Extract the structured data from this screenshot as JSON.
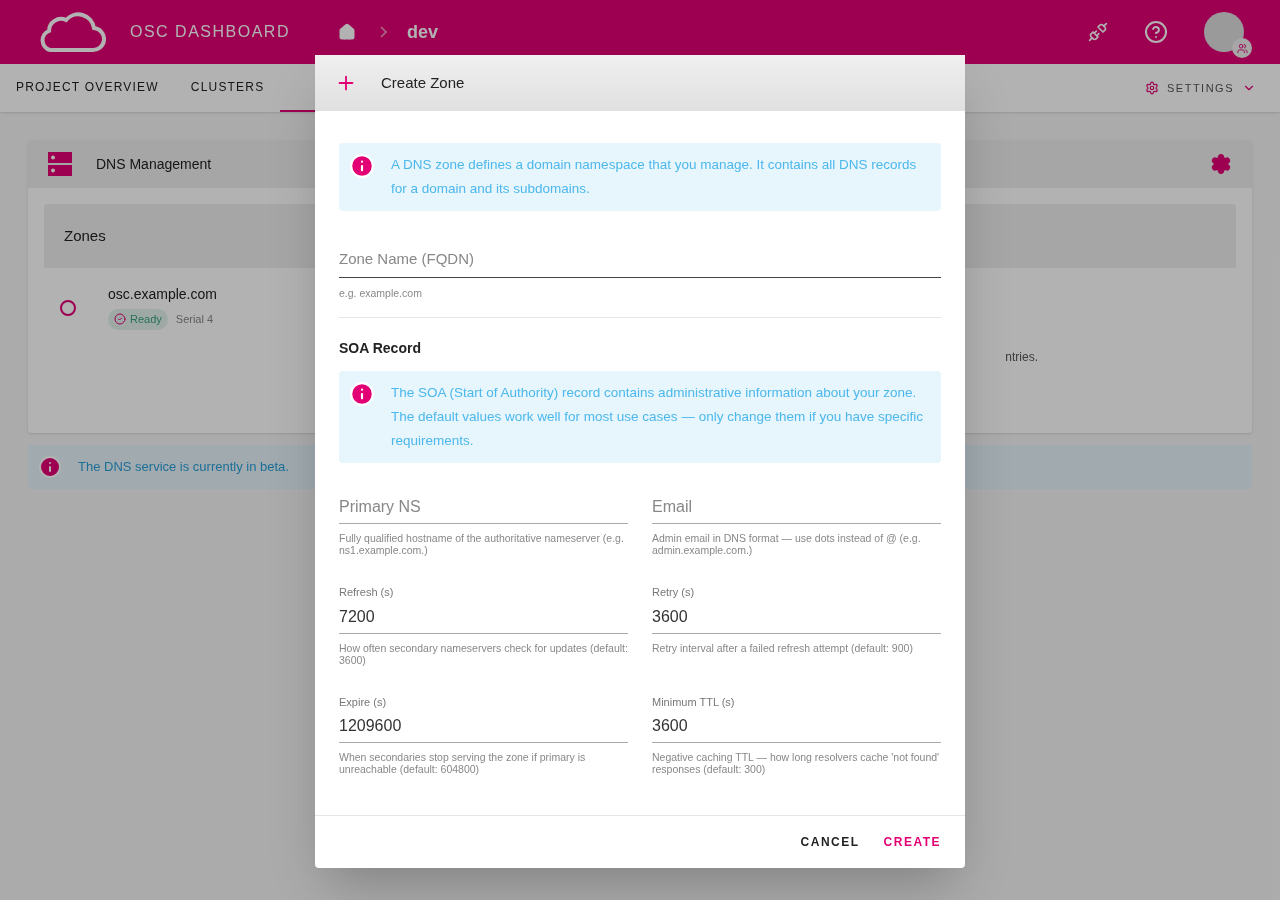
{
  "app_bar": {
    "title": "OSC DASHBOARD",
    "breadcrumb": "dev"
  },
  "tabs": [
    {
      "label": "PROJECT OVERVIEW",
      "selected": false
    },
    {
      "label": "CLUSTERS",
      "selected": false
    },
    {
      "selected": true
    }
  ],
  "settings_menu": {
    "label": "SETTINGS"
  },
  "panel": {
    "title": "DNS Management",
    "zones_header": "Zones",
    "zones": [
      {
        "name": "osc.example.com",
        "status": "Ready",
        "serial": "Serial 4",
        "selected": false
      }
    ],
    "partial_text": "ntries."
  },
  "beta_notice": "The DNS service is currently in beta.",
  "dialog": {
    "title": "Create Zone",
    "intro": "A DNS zone defines a domain namespace that you manage. It contains all DNS records for a domain and its subdomains.",
    "zone_field": {
      "placeholder": "Zone Name (FQDN)",
      "helper": "e.g. example.com",
      "focused": true
    },
    "soa_heading": "SOA Record",
    "soa_info": "The SOA (Start of Authority) record contains administrative information about your zone. The default values work well for most use cases — only change them if you have specific requirements.",
    "fields": [
      {
        "placeholder": "Primary NS",
        "helper": "Fully qualified hostname of the authoritative nameserver (e.g. ns1.example.com.)"
      },
      {
        "placeholder": "Email",
        "helper": "Admin email in DNS format — use dots instead of @ (e.g. admin.example.com.)"
      },
      {
        "label": "Refresh (s)",
        "value": "7200",
        "helper": "How often secondary nameservers check for updates (default: 3600)"
      },
      {
        "label": "Retry (s)",
        "value": "3600",
        "helper": "Retry interval after a failed refresh attempt (default: 900)"
      },
      {
        "label": "Expire (s)",
        "value": "1209600",
        "helper": "When secondaries stop serving the zone if primary is unreachable (default: 604800)"
      },
      {
        "label": "Minimum TTL (s)",
        "value": "3600",
        "helper": "Negative caching TTL — how long resolvers cache 'not found' responses (default: 300)"
      }
    ],
    "buttons": [
      {
        "label": "CANCEL",
        "kind": "secondary"
      },
      {
        "label": "CREATE",
        "kind": "primary"
      }
    ]
  }
}
